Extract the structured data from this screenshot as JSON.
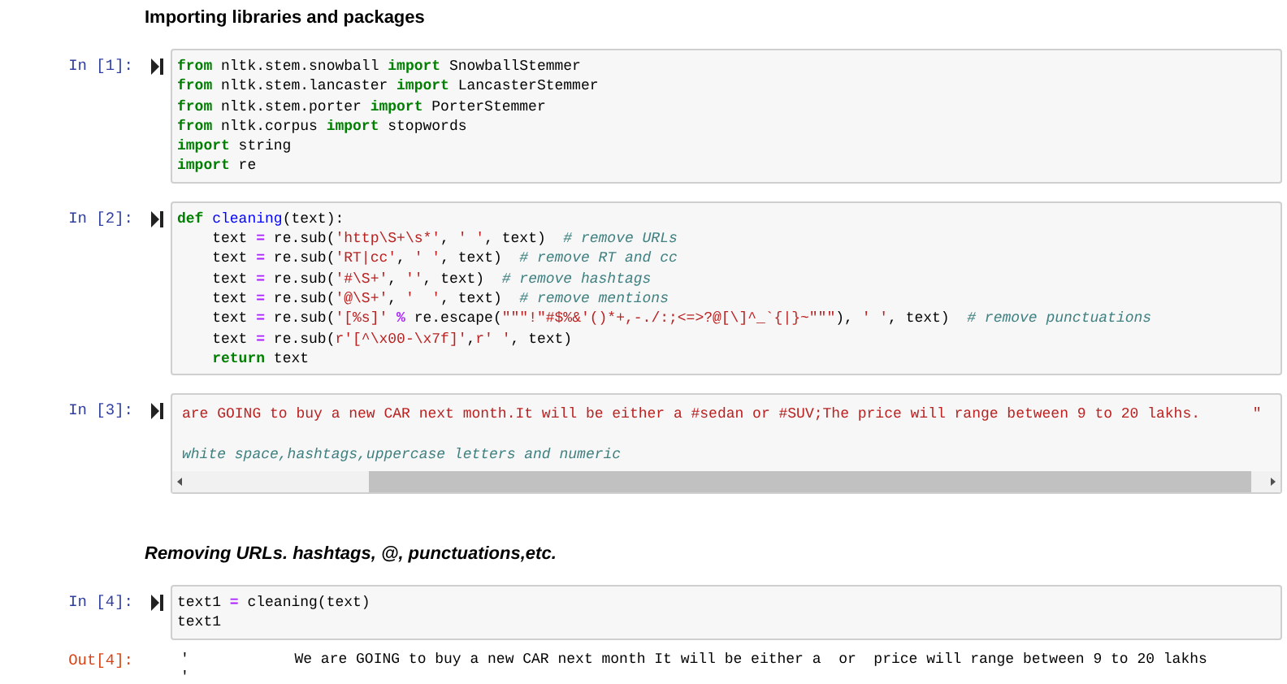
{
  "cells": [
    {
      "kind": "markdown",
      "text": "Importing libraries and packages",
      "italic": false
    },
    {
      "kind": "code",
      "prompt": "In [1]:",
      "horizontal_scroll": false,
      "lines": [
        {
          "tokens": [
            {
              "kind": "kw",
              "text": "from"
            },
            {
              "kind": "plain",
              "text": " nltk.stem.snowball "
            },
            {
              "kind": "kw",
              "text": "import"
            },
            {
              "kind": "plain",
              "text": " SnowballStemmer"
            }
          ]
        },
        {
          "tokens": [
            {
              "kind": "kw",
              "text": "from"
            },
            {
              "kind": "plain",
              "text": " nltk.stem.lancaster "
            },
            {
              "kind": "kw",
              "text": "import"
            },
            {
              "kind": "plain",
              "text": " LancasterStemmer"
            }
          ]
        },
        {
          "tokens": [
            {
              "kind": "kw",
              "text": "from"
            },
            {
              "kind": "plain",
              "text": " nltk.stem.porter "
            },
            {
              "kind": "kw",
              "text": "import"
            },
            {
              "kind": "plain",
              "text": " PorterStemmer"
            }
          ]
        },
        {
          "tokens": [
            {
              "kind": "kw",
              "text": "from"
            },
            {
              "kind": "plain",
              "text": " nltk.corpus "
            },
            {
              "kind": "kw",
              "text": "import"
            },
            {
              "kind": "plain",
              "text": " stopwords"
            }
          ]
        },
        {
          "tokens": [
            {
              "kind": "kw",
              "text": "import"
            },
            {
              "kind": "plain",
              "text": " string"
            }
          ]
        },
        {
          "tokens": [
            {
              "kind": "kw",
              "text": "import"
            },
            {
              "kind": "plain",
              "text": " re"
            }
          ]
        }
      ]
    },
    {
      "kind": "code",
      "prompt": "In [2]:",
      "horizontal_scroll": false,
      "lines": [
        {
          "tokens": [
            {
              "kind": "kw",
              "text": "def"
            },
            {
              "kind": "fn",
              "text": " cleaning"
            },
            {
              "kind": "plain",
              "text": "(text):"
            }
          ]
        },
        {
          "tokens": [
            {
              "kind": "plain",
              "text": "    text "
            },
            {
              "kind": "op",
              "text": "="
            },
            {
              "kind": "plain",
              "text": " re.sub("
            },
            {
              "kind": "str",
              "text": "'http\\S+\\s*'"
            },
            {
              "kind": "plain",
              "text": ", "
            },
            {
              "kind": "str",
              "text": "' '"
            },
            {
              "kind": "plain",
              "text": ", text)  "
            },
            {
              "kind": "com",
              "text": "# remove URLs"
            }
          ]
        },
        {
          "tokens": [
            {
              "kind": "plain",
              "text": "    text "
            },
            {
              "kind": "op",
              "text": "="
            },
            {
              "kind": "plain",
              "text": " re.sub("
            },
            {
              "kind": "str",
              "text": "'RT|cc'"
            },
            {
              "kind": "plain",
              "text": ", "
            },
            {
              "kind": "str",
              "text": "' '"
            },
            {
              "kind": "plain",
              "text": ", text)  "
            },
            {
              "kind": "com",
              "text": "# remove RT and cc"
            }
          ]
        },
        {
          "tokens": [
            {
              "kind": "plain",
              "text": "    text "
            },
            {
              "kind": "op",
              "text": "="
            },
            {
              "kind": "plain",
              "text": " re.sub("
            },
            {
              "kind": "str",
              "text": "'#\\S+'"
            },
            {
              "kind": "plain",
              "text": ", "
            },
            {
              "kind": "str",
              "text": "''"
            },
            {
              "kind": "plain",
              "text": ", text)  "
            },
            {
              "kind": "com",
              "text": "# remove hashtags"
            }
          ]
        },
        {
          "tokens": [
            {
              "kind": "plain",
              "text": "    text "
            },
            {
              "kind": "op",
              "text": "="
            },
            {
              "kind": "plain",
              "text": " re.sub("
            },
            {
              "kind": "str",
              "text": "'@\\S+'"
            },
            {
              "kind": "plain",
              "text": ", "
            },
            {
              "kind": "str",
              "text": "'  '"
            },
            {
              "kind": "plain",
              "text": ", text)  "
            },
            {
              "kind": "com",
              "text": "# remove mentions"
            }
          ]
        },
        {
          "tokens": [
            {
              "kind": "plain",
              "text": "    text "
            },
            {
              "kind": "op",
              "text": "="
            },
            {
              "kind": "plain",
              "text": " re.sub("
            },
            {
              "kind": "str",
              "text": "'[%s]'"
            },
            {
              "kind": "op",
              "text": " %"
            },
            {
              "kind": "plain",
              "text": " re.escape("
            },
            {
              "kind": "str",
              "text": "\"\"\"!\"#$%&'()*+,-./:;<=>?@[\\]^_`{|}~\"\"\""
            },
            {
              "kind": "plain",
              "text": "), "
            },
            {
              "kind": "str",
              "text": "' '"
            },
            {
              "kind": "plain",
              "text": ", text)  "
            },
            {
              "kind": "com",
              "text": "# remove punctuations"
            }
          ]
        },
        {
          "tokens": [
            {
              "kind": "plain",
              "text": "    text "
            },
            {
              "kind": "op",
              "text": "="
            },
            {
              "kind": "plain",
              "text": " re.sub("
            },
            {
              "kind": "str",
              "text": "r'[^\\x00-\\x7f]'"
            },
            {
              "kind": "plain",
              "text": ","
            },
            {
              "kind": "str",
              "text": "r' '"
            },
            {
              "kind": "plain",
              "text": ", text)"
            }
          ]
        },
        {
          "tokens": [
            {
              "kind": "kw",
              "text": "    return"
            },
            {
              "kind": "plain",
              "text": " text"
            }
          ]
        }
      ]
    },
    {
      "kind": "code",
      "prompt": "In [3]:",
      "horizontal_scroll": true,
      "lines": [
        {
          "tokens": [
            {
              "kind": "str",
              "text": "are GOING to buy a new CAR next month.It will be either a #sedan or #SUV;The price will range between 9 to 20 lakhs.      \""
            }
          ]
        },
        {
          "blank_before": true,
          "tokens": [
            {
              "kind": "com",
              "text": "white space,hashtags,uppercase letters and numeric"
            }
          ]
        }
      ]
    },
    {
      "kind": "markdown",
      "text": "Removing URLs. hashtags, @, punctuations,etc.",
      "italic": true
    },
    {
      "kind": "code",
      "prompt": "In [4]:",
      "horizontal_scroll": false,
      "lines": [
        {
          "tokens": [
            {
              "kind": "plain",
              "text": "text1 "
            },
            {
              "kind": "op",
              "text": "="
            },
            {
              "kind": "plain",
              "text": " cleaning(text)"
            }
          ]
        },
        {
          "tokens": [
            {
              "kind": "plain",
              "text": "text1"
            }
          ]
        }
      ]
    },
    {
      "kind": "output",
      "prompt": "Out[4]:",
      "lines": [
        "'            We are GOING to buy a new CAR next month It will be either a  or  price will range between 9 to 20 lakhs",
        "'"
      ]
    }
  ]
}
